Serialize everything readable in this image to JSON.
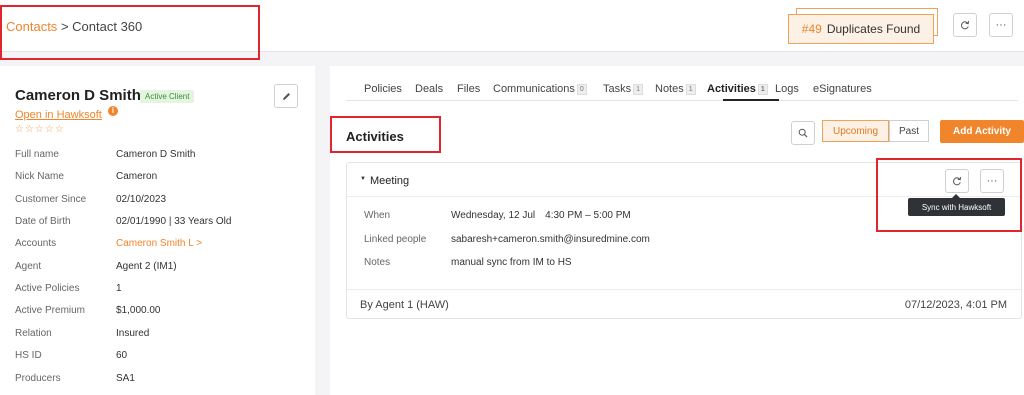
{
  "breadcrumb": {
    "link": "Contacts",
    "separator": ">",
    "current": "Contact 360"
  },
  "duplicates": {
    "number": "#49",
    "label": "Duplicates Found"
  },
  "header_icons": {
    "refresh": "refresh-icon",
    "more": "more-icon"
  },
  "contact": {
    "name": "Cameron D Smith",
    "status": "Active Client",
    "open_link": "Open in Hawksoft",
    "info_icon": "i",
    "rating": "☆☆☆☆☆",
    "fields": [
      {
        "label": "Full name",
        "value": "Cameron D Smith"
      },
      {
        "label": "Nick Name",
        "value": "Cameron"
      },
      {
        "label": "Customer Since",
        "value": "02/10/2023"
      },
      {
        "label": "Date of Birth",
        "value": "02/01/1990 | 33 Years Old"
      },
      {
        "label": "Accounts",
        "value": "Cameron Smith L >"
      },
      {
        "label": "Agent",
        "value": "Agent 2 (IM1)"
      },
      {
        "label": "Active Policies",
        "value": "1"
      },
      {
        "label": "Active Premium",
        "value": "$1,000.00"
      },
      {
        "label": "Relation",
        "value": "Insured"
      },
      {
        "label": "HS ID",
        "value": "60"
      },
      {
        "label": "Producers",
        "value": "SA1"
      }
    ]
  },
  "tabs": [
    {
      "label": "Policies",
      "count": ""
    },
    {
      "label": "Deals",
      "count": ""
    },
    {
      "label": "Files",
      "count": ""
    },
    {
      "label": "Communications",
      "count": "0"
    },
    {
      "label": "Tasks",
      "count": "1"
    },
    {
      "label": "Notes",
      "count": "1"
    },
    {
      "label": "Activities",
      "count": "1"
    },
    {
      "label": "Logs",
      "count": ""
    },
    {
      "label": "eSignatures",
      "count": ""
    }
  ],
  "activities": {
    "title": "Activities",
    "filters": {
      "upcoming": "Upcoming",
      "past": "Past"
    },
    "add_button": "Add Activity",
    "card": {
      "title": "Meeting",
      "tooltip": "Sync with Hawksoft",
      "when_label": "When",
      "when_date": "Wednesday, 12 Jul",
      "when_time": "4:30 PM – 5:00 PM",
      "people_label": "Linked people",
      "people_value": "sabaresh+cameron.smith@insuredmine.com",
      "notes_label": "Notes",
      "notes_value": "manual sync from IM to HS",
      "by": "By Agent 1 (HAW)",
      "timestamp": "07/12/2023, 4:01 PM"
    }
  },
  "colors": {
    "accent": "#f0852c",
    "highlight": "#e0252f",
    "badge_green": "#3d8c3a"
  }
}
